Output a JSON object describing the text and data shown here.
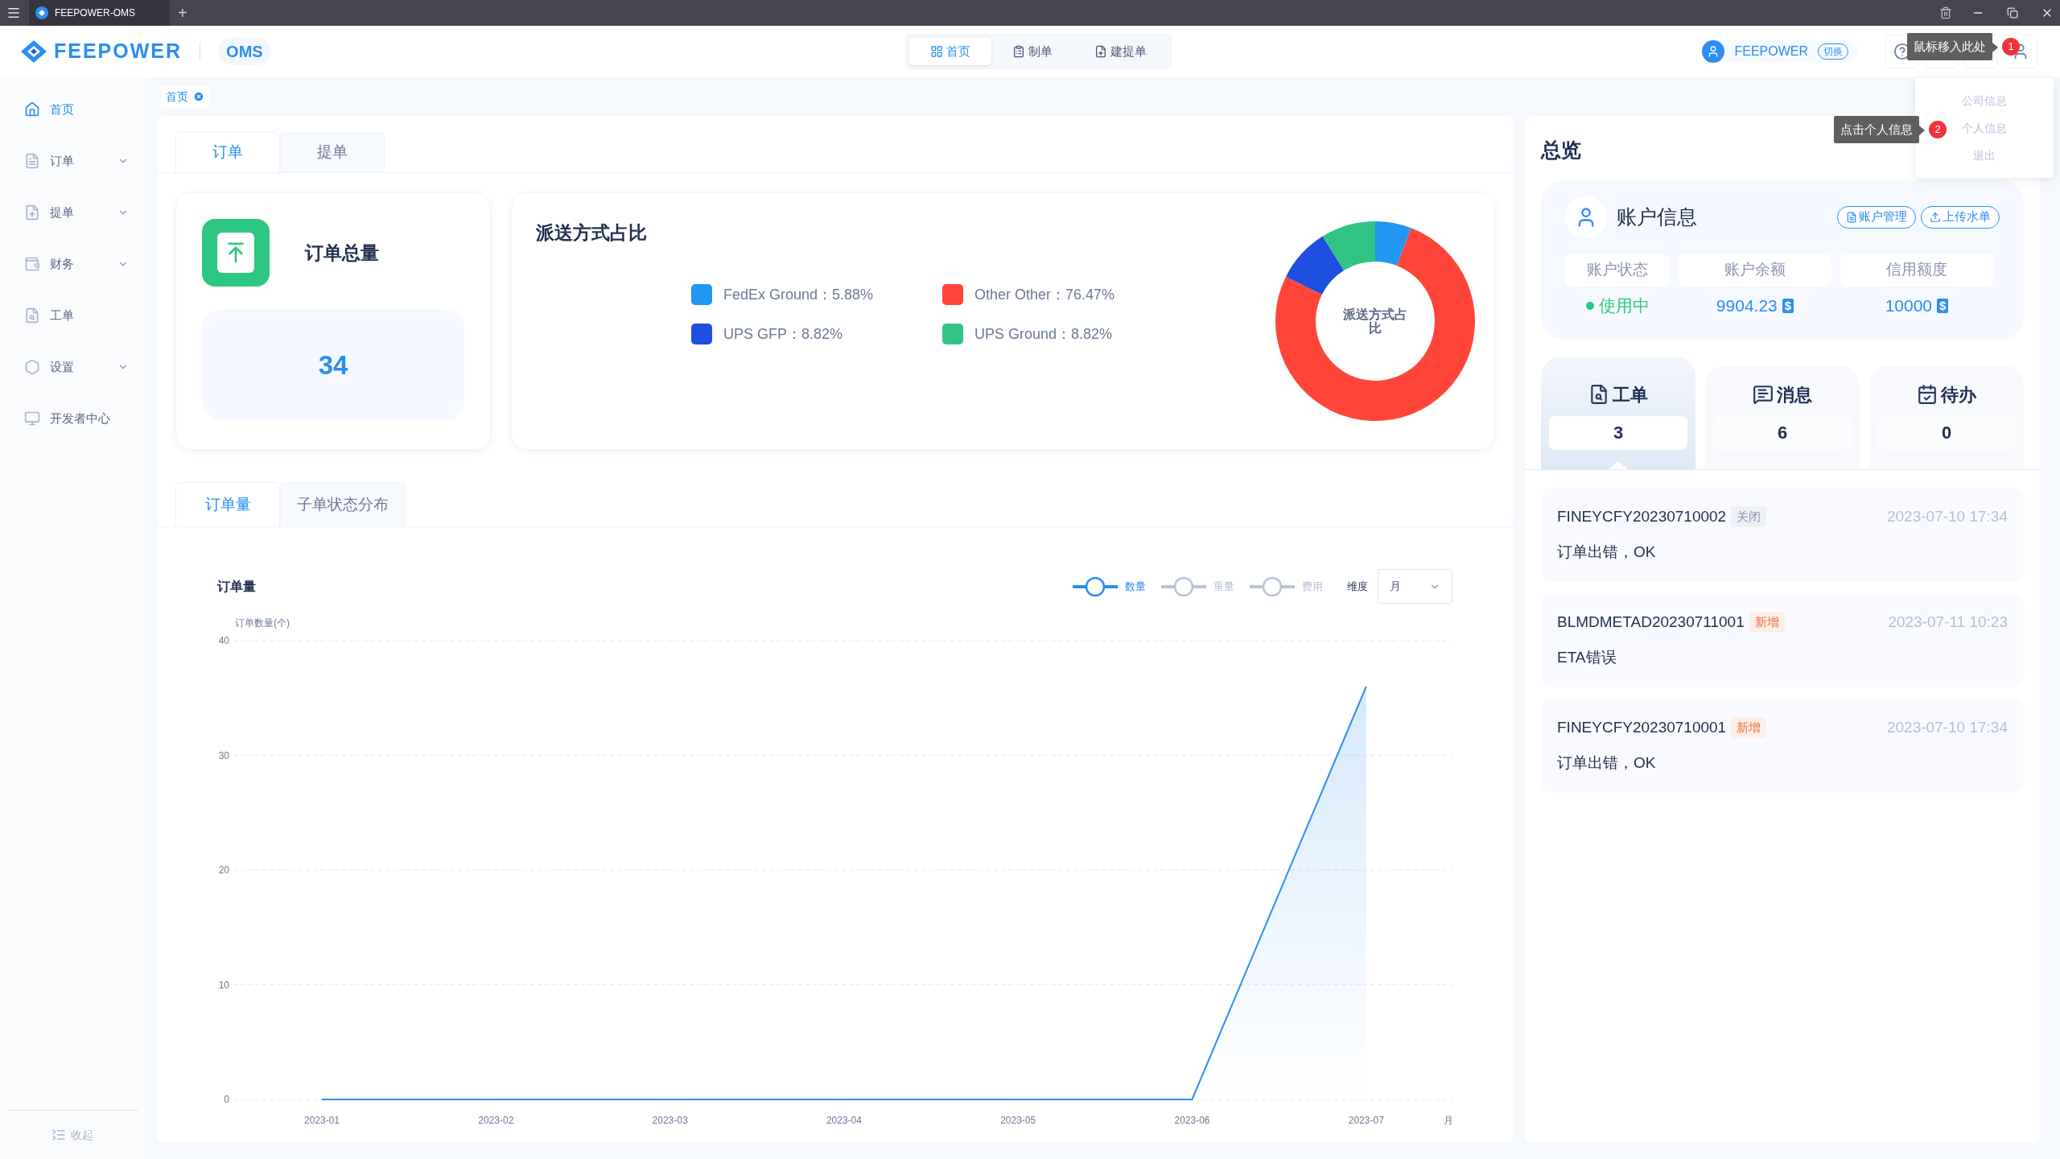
{
  "browser_tab": {
    "title": "FEEPOWER-OMS",
    "new_tab": "+"
  },
  "header": {
    "logo": "FEEPOWER",
    "product": "OMS",
    "nav": [
      {
        "label": "首页",
        "selected": true
      },
      {
        "label": "制单",
        "selected": false
      },
      {
        "label": "建提单",
        "selected": false
      }
    ],
    "account": {
      "name": "FEEPOWER",
      "switch": "切换"
    }
  },
  "tooltips": [
    {
      "badge": "1",
      "text": "鼠标移入此处"
    },
    {
      "badge": "2",
      "text": "点击个人信息"
    }
  ],
  "user_menu": [
    "公司信息",
    "个人信息",
    "退出"
  ],
  "sidebar": {
    "items": [
      {
        "label": "首页",
        "selected": true,
        "kind": "link"
      },
      {
        "label": "订单",
        "selected": false,
        "kind": "group"
      },
      {
        "label": "提单",
        "selected": false,
        "kind": "group"
      },
      {
        "label": "财务",
        "selected": false,
        "kind": "group"
      },
      {
        "label": "工单",
        "selected": false,
        "kind": "link"
      },
      {
        "label": "设置",
        "selected": false,
        "kind": "group"
      },
      {
        "label": "开发者中心",
        "selected": false,
        "kind": "link"
      }
    ],
    "collapse": "收起"
  },
  "breadcrumb": [
    {
      "label": "首页"
    }
  ],
  "order_tabs": [
    {
      "label": "订单",
      "selected": true
    },
    {
      "label": "提单",
      "selected": false
    }
  ],
  "order_total": {
    "title": "订单总量",
    "value": "34"
  },
  "shipping": {
    "title": "派送方式占比",
    "legend": [
      {
        "color": "#2196f3"
      },
      {
        "color": "#ff453a"
      },
      {
        "color": "#1f4fe0"
      },
      {
        "color": "#30c584"
      }
    ],
    "chart_data": {
      "type": "donut",
      "title": "派送方式占比",
      "categories": [
        "FedEx Ground：5.88%",
        "Other Other：76.47%",
        "UPS GFP：8.82%",
        "UPS Ground：8.82%"
      ],
      "values": [
        5.88,
        76.47,
        8.82,
        8.82
      ]
    }
  },
  "chart_tabs": [
    {
      "label": "订单量",
      "selected": true
    },
    {
      "label": "子单状态分布",
      "selected": false
    }
  ],
  "order_chart": {
    "toggles": [
      {
        "label": "数量",
        "selected": true
      },
      {
        "label": "重量",
        "selected": false
      },
      {
        "label": "费用",
        "selected": false
      }
    ],
    "dimension": {
      "label": "维度",
      "value": "月"
    },
    "chart_data": {
      "type": "area",
      "title": "订单量",
      "xlabel": "月",
      "ylabel": "订单数量(个)",
      "categories": [
        "2023-01",
        "2023-02",
        "2023-03",
        "2023-04",
        "2023-05",
        "2023-06",
        "2023-07"
      ],
      "series": [
        {
          "color": "#2b8ef0",
          "values": [
            0,
            0,
            0,
            0,
            0,
            0,
            36
          ]
        }
      ],
      "ylim": [
        0,
        40
      ],
      "yticks": [
        0,
        10,
        20,
        30,
        40
      ],
      "grid": true
    }
  },
  "overview": {
    "title": "总览",
    "account": {
      "title": "账户信息",
      "buttons": [
        "账户管理",
        "上传水单"
      ],
      "fields": [
        {
          "label": "账户状态",
          "value": "使用中",
          "kind": "status"
        },
        {
          "label": "账户余额",
          "value": "9904.23",
          "kind": "money",
          "currency": "$"
        },
        {
          "label": "信用额度",
          "value": "10000",
          "kind": "money",
          "currency": "$"
        }
      ]
    },
    "stats": [
      {
        "label": "工单",
        "value": "3",
        "selected": true
      },
      {
        "label": "消息",
        "value": "6",
        "selected": false
      },
      {
        "label": "待办",
        "value": "0",
        "selected": false
      }
    ],
    "tickets": [
      {
        "id": "FINEYCFY20230710002",
        "status": "关闭",
        "kind": "closed",
        "time": "2023-07-10 17:34",
        "text": "订单出错，OK"
      },
      {
        "id": "BLMDMETAD20230711001",
        "status": "新增",
        "kind": "new",
        "time": "2023-07-11 10:23",
        "text": "ETA错误"
      },
      {
        "id": "FINEYCFY20230710001",
        "status": "新增",
        "kind": "new",
        "time": "2023-07-10 17:34",
        "text": "订单出错，OK"
      }
    ]
  }
}
